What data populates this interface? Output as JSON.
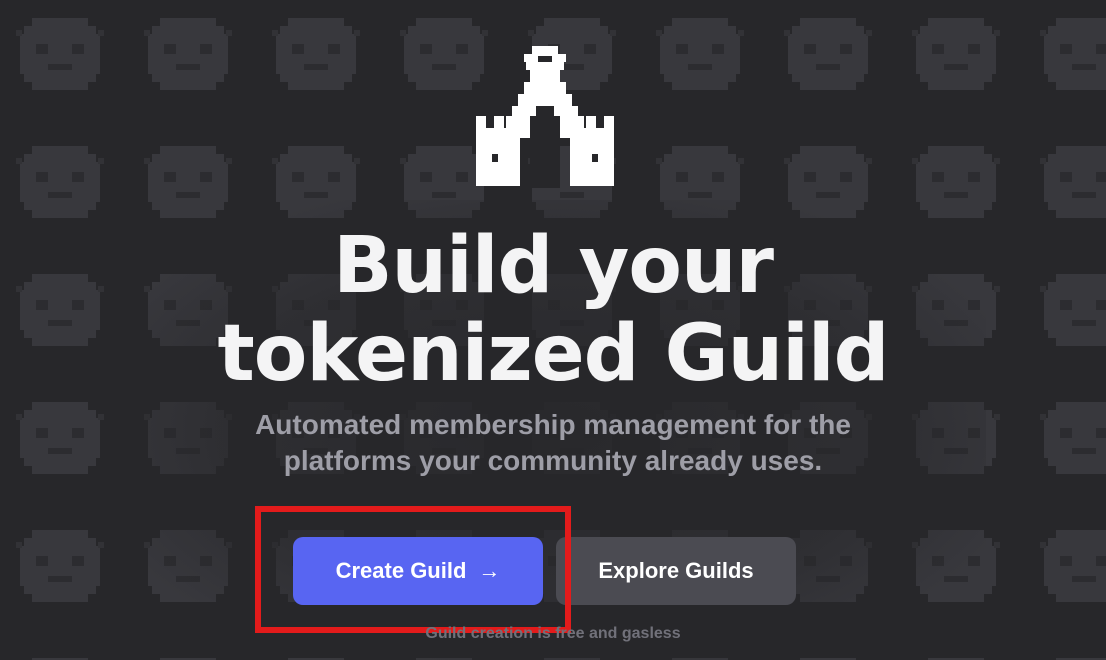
{
  "hero": {
    "title_line1": "Build your",
    "title_line2": "tokenized Guild",
    "subtitle_line1": "Automated membership management for the",
    "subtitle_line2": "platforms your community already uses."
  },
  "actions": {
    "create_label": "Create Guild",
    "create_icon": "arrow-right-icon",
    "arrow_glyph": "→",
    "explore_label": "Explore Guilds"
  },
  "footnote": "Guild creation is free and gasless",
  "colors": {
    "background": "#27272a",
    "primary_button": "#5865f2",
    "secondary_button": "#4b4b52",
    "highlight_border": "#e31b1b"
  }
}
